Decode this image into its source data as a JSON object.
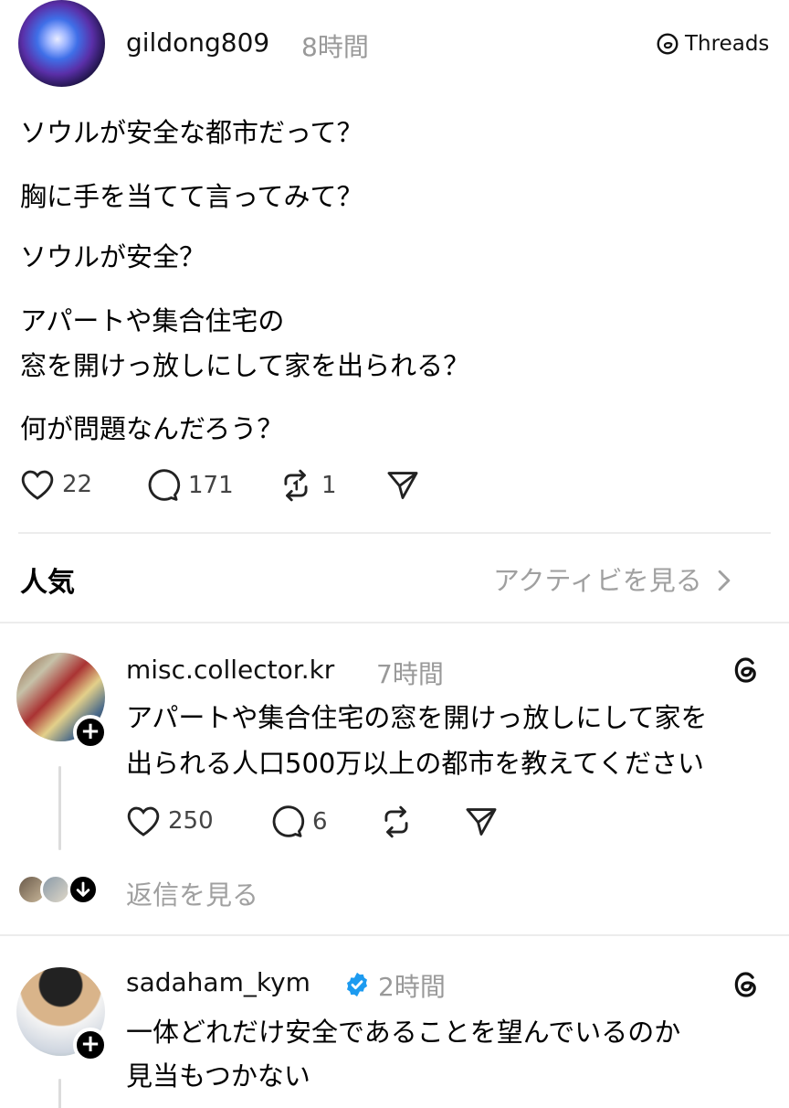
{
  "post": {
    "username": "gildong809",
    "time": "8時間",
    "source_label": "Threads",
    "lines": [
      "ソウルが安全な都市だって？",
      "胸に手を当てて言ってみて？",
      "ソウルが安全？",
      "アパートや集合住宅の",
      "窓を開けっ放しにして家を出られる？",
      "何が問題なんだろう？"
    ],
    "likes": "22",
    "comments": "171",
    "reposts": "1"
  },
  "section": {
    "title": "人気",
    "activity_link": "アクティビを見る"
  },
  "replies": [
    {
      "username": "misc.collector.kr",
      "time": "7時間",
      "lines": [
        "アパートや集合住宅の窓を開けっ放しにして家を",
        "出られる人口500万以上の都市を教えてください"
      ],
      "likes": "250",
      "comments": "6",
      "see_replies": "返信を見る"
    },
    {
      "username": "sadaham_kym",
      "time": "2時間",
      "lines": [
        "一体どれだけ安全であることを望んでいるのか",
        "見当もつかない"
      ]
    }
  ],
  "colors": {
    "verified": "#1d9bf0",
    "muted": "#999999",
    "divider": "#ececec"
  },
  "icons": [
    "heart-icon",
    "comment-icon",
    "repost-icon",
    "share-icon",
    "threads-logo-icon",
    "verified-badge-icon",
    "chevron-right-icon",
    "arrow-down-icon"
  ]
}
